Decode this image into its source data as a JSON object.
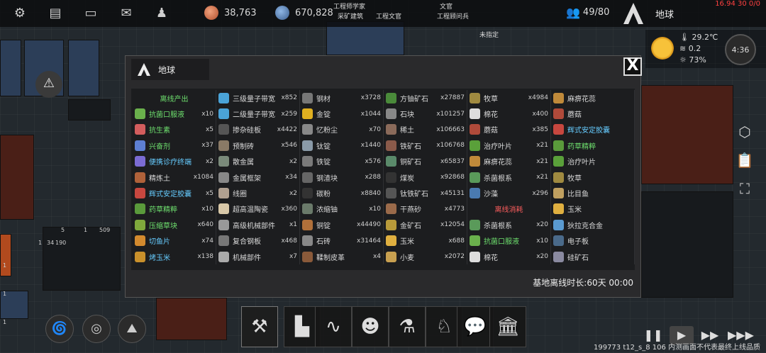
{
  "colors": {
    "green": "#6ee06e",
    "cyan": "#66ccff",
    "red": "#ff5e5e",
    "accent": "#f2a21b"
  },
  "topbar": {
    "icons": [
      "gear-icon",
      "chat-icon",
      "message-icon",
      "mail-icon",
      "person-icon"
    ],
    "resource1": "38,763",
    "resource2": "670,828",
    "work_tags": [
      "工程师学家",
      "采矿建筑",
      "工程文官",
      "文官",
      "工程顾问兵",
      "未指定"
    ],
    "population": "49/80",
    "planet": "地球",
    "delta": "16.94 30 0/0"
  },
  "weather": {
    "temp": "29.2℃",
    "wind": "0.2",
    "humidity": "73%",
    "time": "4:36"
  },
  "map_labels": [
    "5",
    "509",
    "1",
    "1",
    "34",
    "190",
    "1",
    "1",
    "1"
  ],
  "modal": {
    "title": "地球",
    "close": "X",
    "offline": "基地离线时长:60天 00:00",
    "columns": [
      [
        {
          "header": "离线产出",
          "tone": "g"
        },
        {
          "name": "抗菌口服液",
          "count": "x10",
          "tone": "green",
          "icon": "#6ab04c"
        },
        {
          "name": "抗生素",
          "count": "x5",
          "tone": "green",
          "icon": "#d35d5d"
        },
        {
          "name": "兴奋剂",
          "count": "x37",
          "tone": "green",
          "icon": "#5d7fd3"
        },
        {
          "name": "便携诊疗终端",
          "count": "x2",
          "tone": "cyan",
          "icon": "#7b6bd3"
        },
        {
          "name": "精炼土",
          "count": "x1084",
          "tone": "",
          "icon": "#b0623a"
        },
        {
          "name": "辉式安定胶囊",
          "count": "x5",
          "tone": "cyan",
          "icon": "#c7473f"
        },
        {
          "name": "药草精粹",
          "count": "x10",
          "tone": "green",
          "icon": "#5a9a3b"
        },
        {
          "name": "压缩草块",
          "count": "x640",
          "tone": "green",
          "icon": "#7fa83c"
        },
        {
          "name": "切鱼片",
          "count": "x74",
          "tone": "cyan",
          "icon": "#d38a2e"
        },
        {
          "name": "烤玉米",
          "count": "x138",
          "tone": "cyan",
          "icon": "#c9902b"
        }
      ],
      [
        {
          "name": "三级量子带宽",
          "count": "x852",
          "tone": "",
          "icon": "#4aa3d8"
        },
        {
          "name": "二级量子带宽",
          "count": "x259",
          "tone": "",
          "icon": "#4aa3d8"
        },
        {
          "name": "掺杂硅板",
          "count": "x4422",
          "tone": "",
          "icon": "#555555"
        },
        {
          "name": "预制砖",
          "count": "x546",
          "tone": "",
          "icon": "#8a7a66"
        },
        {
          "name": "散金属",
          "count": "x2",
          "tone": "",
          "icon": "#7a8a7a"
        },
        {
          "name": "金属框架",
          "count": "x34",
          "tone": "",
          "icon": "#888888"
        },
        {
          "name": "线圈",
          "count": "x2",
          "tone": "",
          "icon": "#b0a090"
        },
        {
          "name": "超高温陶瓷",
          "count": "x360",
          "tone": "",
          "icon": "#d8c8a8"
        },
        {
          "name": "高级机械部件",
          "count": "x1",
          "tone": "",
          "icon": "#999999"
        },
        {
          "name": "复合钢板",
          "count": "x468",
          "tone": "",
          "icon": "#777777"
        },
        {
          "name": "机械部件",
          "count": "x7",
          "tone": "",
          "icon": "#aaaaaa"
        }
      ],
      [
        {
          "name": "钢材",
          "count": "x3728",
          "tone": "",
          "icon": "#777777"
        },
        {
          "name": "金锭",
          "count": "x1044",
          "tone": "",
          "icon": "#e0b020"
        },
        {
          "name": "忆粉尘",
          "count": "x70",
          "tone": "",
          "icon": "#888888"
        },
        {
          "name": "钛锭",
          "count": "x1440",
          "tone": "",
          "icon": "#8a9aa8"
        },
        {
          "name": "铁锭",
          "count": "x576",
          "tone": "",
          "icon": "#7a7a7a"
        },
        {
          "name": "钢渣块",
          "count": "x288",
          "tone": "",
          "icon": "#666666"
        },
        {
          "name": "碳粉",
          "count": "x8840",
          "tone": "",
          "icon": "#333333"
        },
        {
          "name": "浓缩铀",
          "count": "x10",
          "tone": "",
          "icon": "#6a7a6a"
        },
        {
          "name": "铜锭",
          "count": "x44490",
          "tone": "",
          "icon": "#b0703a"
        },
        {
          "name": "石砖",
          "count": "x31464",
          "tone": "",
          "icon": "#888888"
        },
        {
          "name": "鞣制皮革",
          "count": "x4",
          "tone": "",
          "icon": "#8a5a3a"
        }
      ],
      [
        {
          "name": "方铀矿石",
          "count": "x27887",
          "tone": "",
          "icon": "#4a8a3a"
        },
        {
          "name": "石块",
          "count": "x101257",
          "tone": "",
          "icon": "#888888"
        },
        {
          "name": "稀土",
          "count": "x106663",
          "tone": "",
          "icon": "#8a6a5a"
        },
        {
          "name": "铁矿石",
          "count": "x106768",
          "tone": "",
          "icon": "#8a5a4a"
        },
        {
          "name": "铜矿石",
          "count": "x65837",
          "tone": "",
          "icon": "#5a8a6a"
        },
        {
          "name": "煤炭",
          "count": "x92868",
          "tone": "",
          "icon": "#333333"
        },
        {
          "name": "钛铁矿石",
          "count": "x45131",
          "tone": "",
          "icon": "#555555"
        },
        {
          "name": "干燕砂",
          "count": "x4773",
          "tone": "",
          "icon": "#9a6a4a"
        },
        {
          "name": "金矿石",
          "count": "x12054",
          "tone": "",
          "icon": "#b89a3a"
        },
        {
          "name": "玉米",
          "count": "x688",
          "tone": "",
          "icon": "#e0b040"
        },
        {
          "name": "小麦",
          "count": "x2072",
          "tone": "",
          "icon": "#c8a050"
        }
      ],
      [
        {
          "name": "牧草",
          "count": "x4984",
          "tone": "",
          "icon": "#a08a40"
        },
        {
          "name": "棉花",
          "count": "x400",
          "tone": "",
          "icon": "#dddddd"
        },
        {
          "name": "蘑菇",
          "count": "x385",
          "tone": "",
          "icon": "#b04a3a"
        },
        {
          "name": "治疗叶片",
          "count": "x21",
          "tone": "",
          "icon": "#5aa03a"
        },
        {
          "name": "麻痹花蕊",
          "count": "x21",
          "tone": "",
          "icon": "#c08a3a"
        },
        {
          "name": "杀菌根系",
          "count": "x21",
          "tone": "",
          "icon": "#5a9a5a"
        },
        {
          "name": "沙藻",
          "count": "x296",
          "tone": "",
          "icon": "#4a7ab0"
        },
        {
          "header": "离线消耗",
          "tone": "r"
        },
        {
          "name": "杀菌根系",
          "count": "x20",
          "tone": "",
          "icon": "#5a9a5a"
        },
        {
          "name": "抗菌口服液",
          "count": "x10",
          "tone": "green",
          "icon": "#6ab04c"
        },
        {
          "name": "棉花",
          "count": "x20",
          "tone": "",
          "icon": "#dddddd"
        }
      ],
      [
        {
          "name": "麻痹花蕊",
          "count": "",
          "tone": "",
          "icon": "#c08a3a"
        },
        {
          "name": "蘑菇",
          "count": "",
          "tone": "",
          "icon": "#b04a3a"
        },
        {
          "name": "辉式安定胶囊",
          "count": "",
          "tone": "cyan",
          "icon": "#c7473f"
        },
        {
          "name": "药草精粹",
          "count": "",
          "tone": "green",
          "icon": "#5a9a3b"
        },
        {
          "name": "治疗叶片",
          "count": "",
          "tone": "",
          "icon": "#5aa03a"
        },
        {
          "name": "牧草",
          "count": "",
          "tone": "",
          "icon": "#a08a40"
        },
        {
          "name": "比目鱼",
          "count": "",
          "tone": "",
          "icon": "#c0a060"
        },
        {
          "name": "玉米",
          "count": "",
          "tone": "",
          "icon": "#e0b040"
        },
        {
          "name": "狄拉克合金",
          "count": "",
          "tone": "",
          "icon": "#5a9ad0"
        },
        {
          "name": "电子板",
          "count": "",
          "tone": "",
          "icon": "#4a6a8a"
        },
        {
          "name": "硅矿石",
          "count": "",
          "tone": "",
          "icon": "#8a8aa0"
        }
      ]
    ]
  },
  "bottombar": {
    "round_buttons": [
      "galaxy-icon",
      "orbit-icon",
      "mountain-icon"
    ],
    "buttons": [
      "tools-icon",
      "blueprint-icon",
      "audio-wave-icon",
      "crowd-icon",
      "flask-icon",
      "beast-icon",
      "chat-bubble-icon",
      "museum-icon"
    ],
    "speeds": [
      "pause-icon",
      "play-icon",
      "fast-forward-icon",
      "fastest-icon"
    ],
    "build_note": "199773 t12_s_8 106 内测画面不代表最终上线品质"
  }
}
